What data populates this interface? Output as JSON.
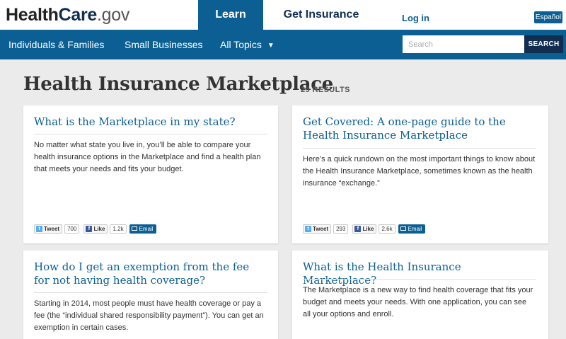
{
  "header": {
    "logo": {
      "part1": "Health",
      "part2": "Care",
      "part3": ".gov"
    },
    "nav_learn": "Learn",
    "nav_get_insurance": "Get Insurance",
    "nav_login": "Log in",
    "lang": "Español"
  },
  "subnav": {
    "items": [
      {
        "label": "Individuals & Families"
      },
      {
        "label": "Small Businesses"
      },
      {
        "label": "All Topics"
      }
    ],
    "search_placeholder": "Search",
    "search_button": "SEARCH"
  },
  "main": {
    "title": "Health Insurance Marketplace",
    "results": "25 RESULTS",
    "cards": [
      {
        "title": "What is the Marketplace in my state?",
        "body": "No matter what state you live in, you’ll be able to compare your health insurance options in the Marketplace and find a health plan that meets your needs and fits your budget.",
        "social": {
          "tweet": "Tweet",
          "tweet_count": "700",
          "like": "Like",
          "like_count": "1.2k",
          "email": "Email"
        }
      },
      {
        "title": "Get Covered: A one-page guide to the Health Insurance Marketplace",
        "body": "Here’s a quick rundown on the most important things to know about the Health Insurance Marketplace, sometimes known as the health insurance “exchange.”",
        "social": {
          "tweet": "Tweet",
          "tweet_count": "293",
          "like": "Like",
          "like_count": "2.6k",
          "email": "Email"
        }
      },
      {
        "title": "How do I get an exemption from the fee for not having health coverage?",
        "body": "Starting in 2014, most people must have health coverage or pay a fee (the “individual shared responsibility payment”). You can get an exemption in certain cases."
      },
      {
        "title": "What is the Health Insurance Marketplace?",
        "body": "The Marketplace is a new way to find health coverage that fits your budget and meets your needs. With one application, you can see all your options and enroll."
      }
    ]
  },
  "icons": {
    "tweet": "twitter-bird-icon",
    "like": "facebook-f-icon",
    "email": "envelope-icon",
    "dropdown": "chevron-down-icon"
  },
  "colors": {
    "brand_blue": "#0b5f93",
    "navy": "#112e51",
    "page_bg": "#ebebeb"
  }
}
